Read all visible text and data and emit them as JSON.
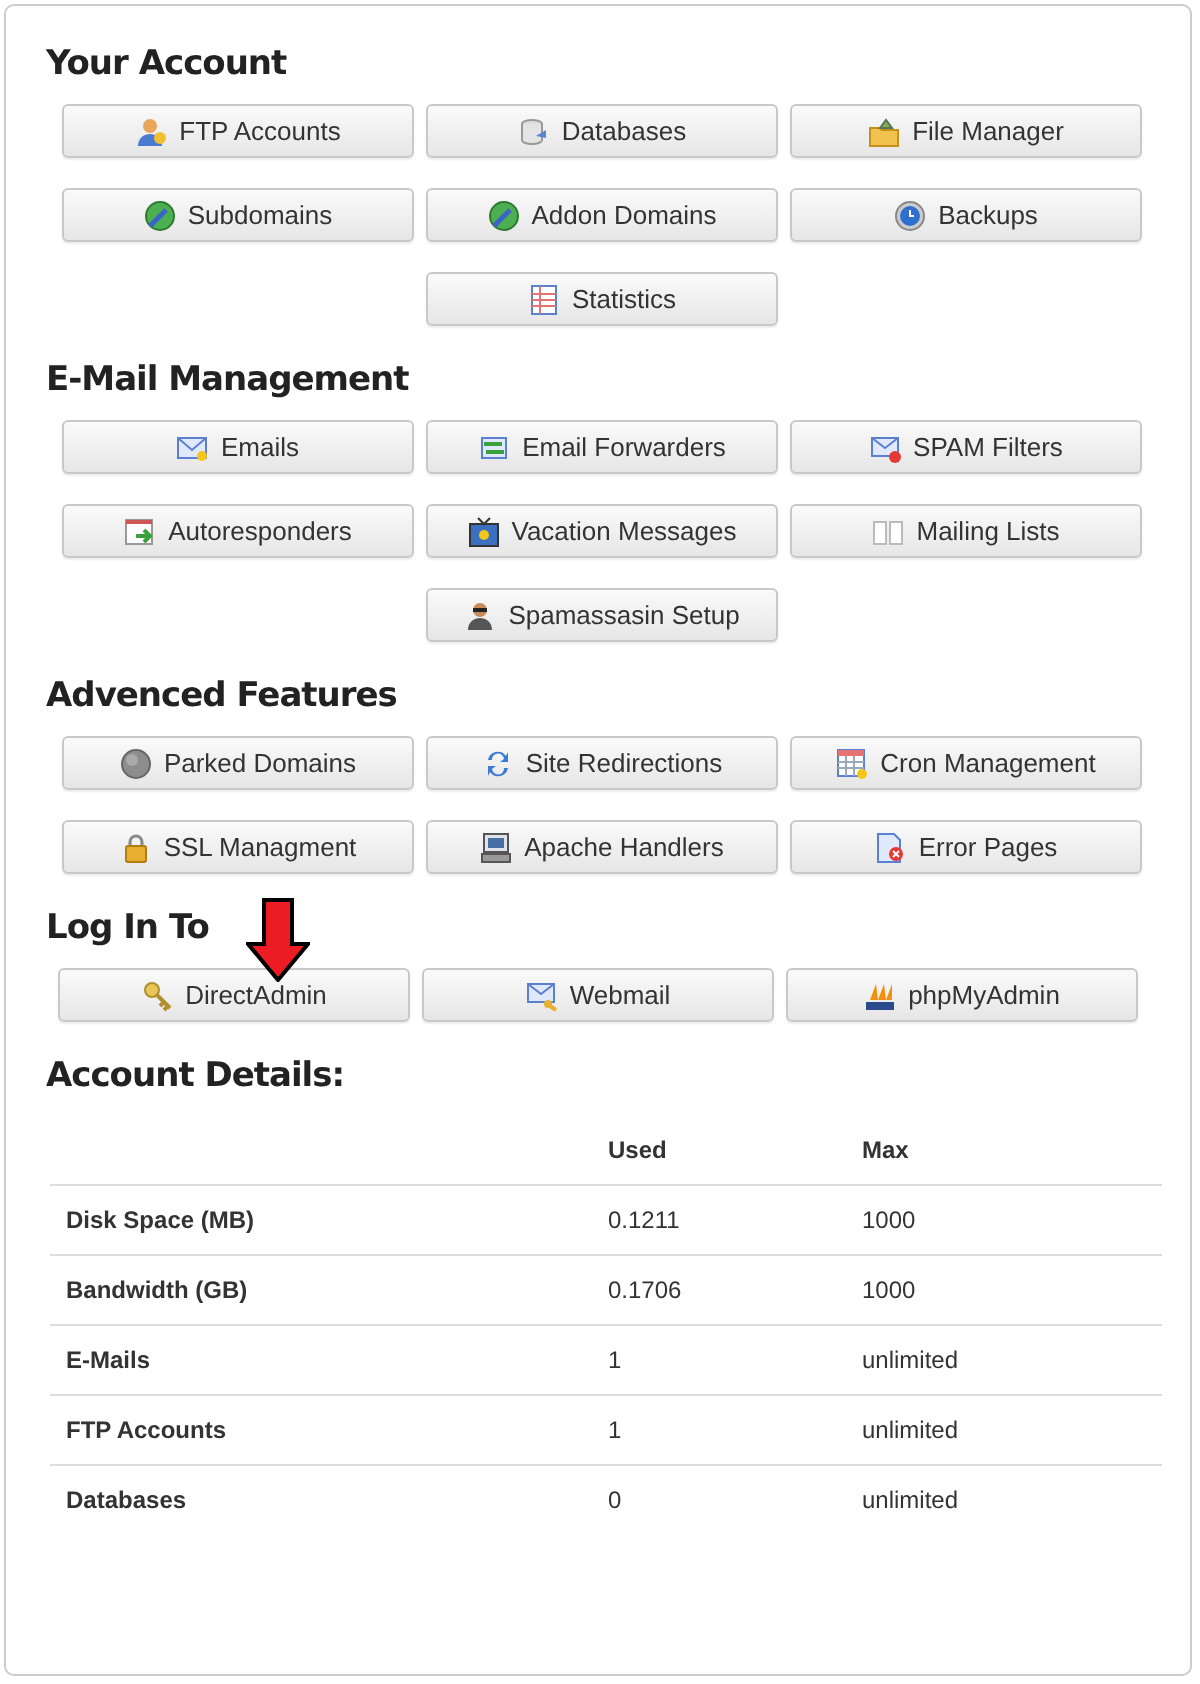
{
  "sections": [
    {
      "title": "Your Account",
      "buttons": [
        "FTP Accounts",
        "Databases",
        "File Manager",
        "Subdomains",
        "Addon Domains",
        "Backups",
        "Statistics"
      ]
    },
    {
      "title": "E-Mail Management",
      "buttons": [
        "Emails",
        "Email Forwarders",
        "SPAM Filters",
        "Autoresponders",
        "Vacation Messages",
        "Mailing Lists",
        "Spamassasin Setup"
      ]
    },
    {
      "title": "Advenced Features",
      "buttons": [
        "Parked Domains",
        "Site Redirections",
        "Cron Management",
        "SSL Managment",
        "Apache Handlers",
        "Error Pages"
      ]
    },
    {
      "title": "Log In To",
      "buttons": [
        "DirectAdmin",
        "Webmail",
        "phpMyAdmin"
      ]
    }
  ],
  "account_details": {
    "title": "Account Details:",
    "columns": [
      "Used",
      "Max"
    ],
    "rows": [
      {
        "label": "Disk Space (MB)",
        "used": "0.1211",
        "max": "1000"
      },
      {
        "label": "Bandwidth (GB)",
        "used": "0.1706",
        "max": "1000"
      },
      {
        "label": "E-Mails",
        "used": "1",
        "max": "unlimited"
      },
      {
        "label": "FTP Accounts",
        "used": "1",
        "max": "unlimited"
      },
      {
        "label": "Databases",
        "used": "0",
        "max": "unlimited"
      }
    ]
  }
}
